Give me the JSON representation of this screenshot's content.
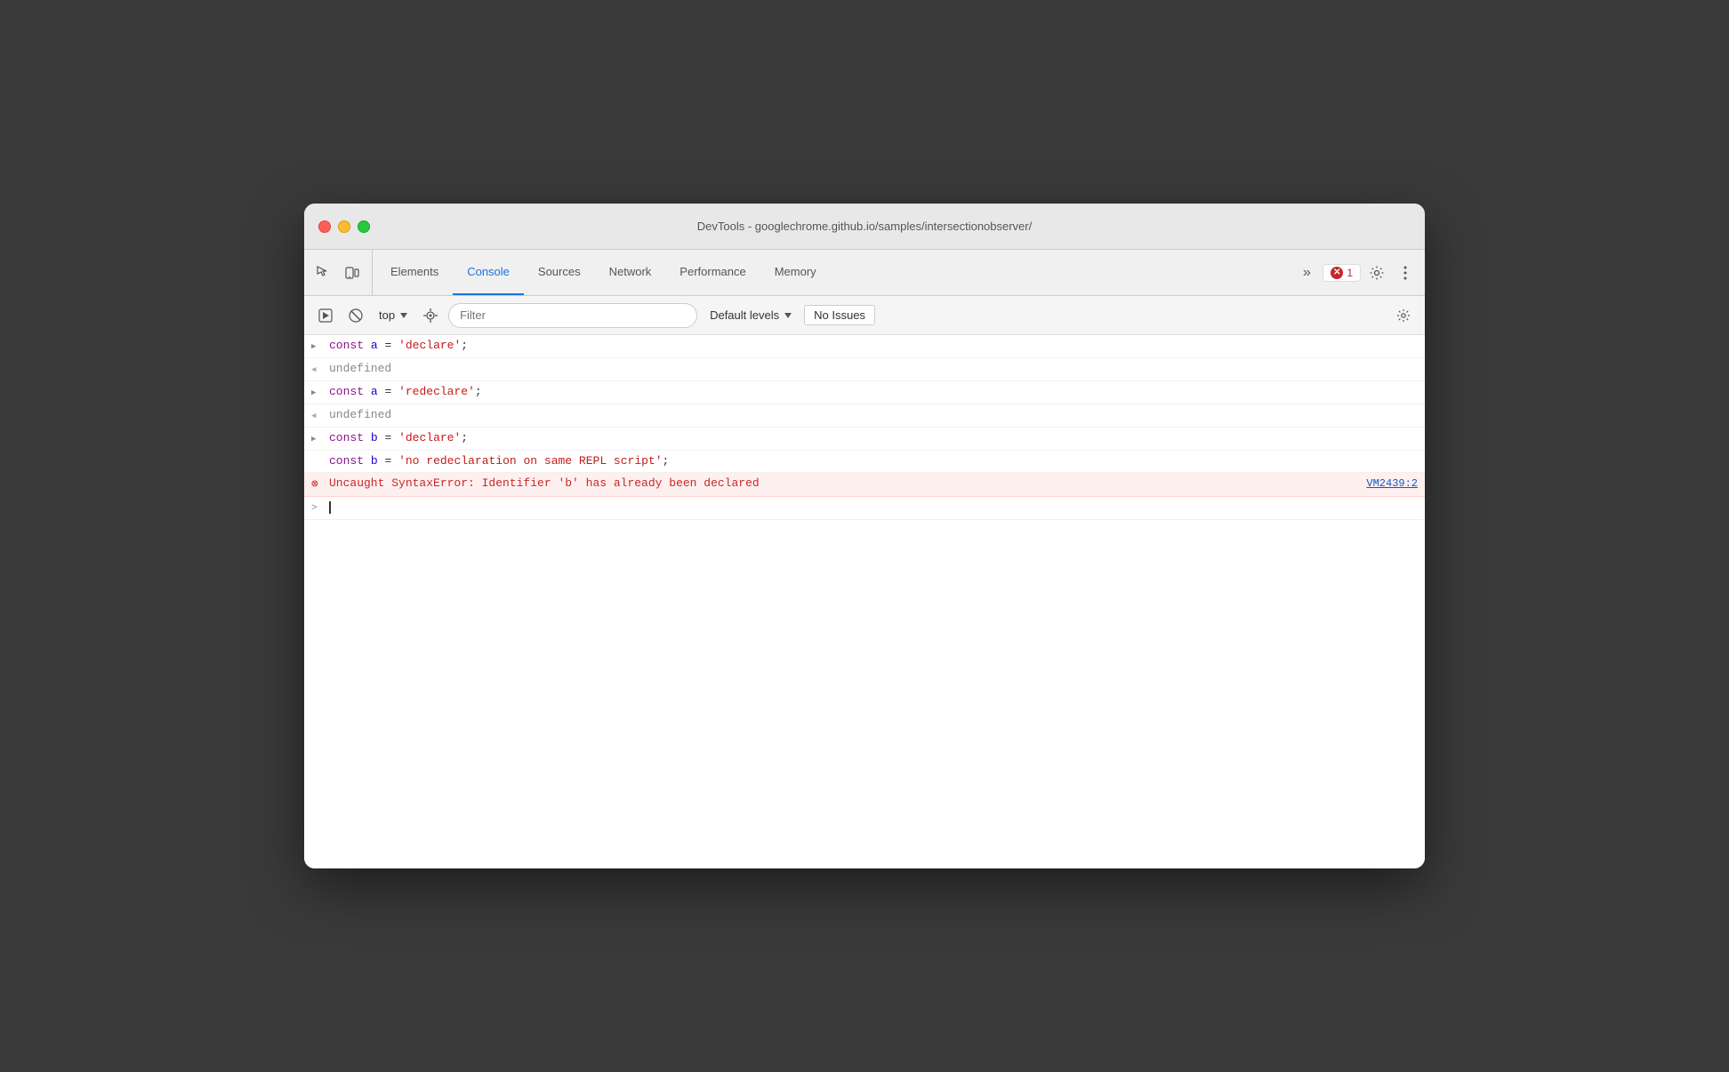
{
  "window": {
    "title": "DevTools - googlechrome.github.io/samples/intersectionobserver/"
  },
  "traffic_lights": {
    "red_label": "close",
    "yellow_label": "minimize",
    "green_label": "maximize"
  },
  "tabs": {
    "items": [
      {
        "id": "elements",
        "label": "Elements",
        "active": false
      },
      {
        "id": "console",
        "label": "Console",
        "active": true
      },
      {
        "id": "sources",
        "label": "Sources",
        "active": false
      },
      {
        "id": "network",
        "label": "Network",
        "active": false
      },
      {
        "id": "performance",
        "label": "Performance",
        "active": false
      },
      {
        "id": "memory",
        "label": "Memory",
        "active": false
      }
    ],
    "more_label": "»",
    "error_count": "1",
    "settings_label": "⚙",
    "more_options_label": "⋮"
  },
  "console_toolbar": {
    "run_label": "▶",
    "clear_label": "🚫",
    "context_label": "top",
    "eye_label": "👁",
    "filter_placeholder": "Filter",
    "levels_label": "Default levels",
    "no_issues_label": "No Issues",
    "settings_label": "⚙"
  },
  "console_lines": [
    {
      "type": "input",
      "arrow": "chevron-right",
      "html": "<span class='kw'>const</span> <span class='id'>a</span> <span class='pun'>=</span> <span class='str'>'declare'</span><span class='pun'>;</span>"
    },
    {
      "type": "output",
      "arrow": "chevron-left",
      "html": "<span class='und'>undefined</span>"
    },
    {
      "type": "input",
      "arrow": "chevron-right",
      "html": "<span class='kw'>const</span> <span class='id'>a</span> <span class='pun'>=</span> <span class='str'>'redeclare'</span><span class='pun'>;</span>"
    },
    {
      "type": "output",
      "arrow": "chevron-left",
      "html": "<span class='und'>undefined</span>"
    },
    {
      "type": "input",
      "arrow": "chevron-right",
      "html": "<span class='kw'>const</span> <span class='id'>b</span> <span class='pun'>=</span> <span class='str'>'declare'</span><span class='pun'>;</span>"
    },
    {
      "type": "input-continuation",
      "arrow": "",
      "html": "<span class='kw'>const</span> <span class='id'>b</span> <span class='pun'>=</span> <span class='str'>'no redeclaration on same REPL script'</span><span class='pun'>;</span>"
    },
    {
      "type": "error",
      "arrow": "error-icon-sm",
      "html": "<span class='err-text'>Uncaught SyntaxError: Identifier 'b' has already been declared</span>",
      "source": "VM2439:2"
    },
    {
      "type": "prompt",
      "arrow": "prompt",
      "html": ""
    }
  ]
}
